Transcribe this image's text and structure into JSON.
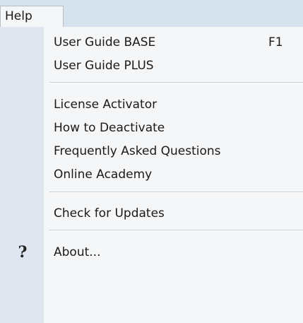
{
  "menubar": {
    "help_label": "Help"
  },
  "menu": {
    "items": [
      {
        "label": "User Guide BASE",
        "shortcut": "F1"
      },
      {
        "label": "User Guide PLUS",
        "shortcut": ""
      },
      {
        "label": "License Activator",
        "shortcut": ""
      },
      {
        "label": "How to Deactivate",
        "shortcut": ""
      },
      {
        "label": "Frequently Asked Questions",
        "shortcut": ""
      },
      {
        "label": "Online Academy",
        "shortcut": ""
      },
      {
        "label": "Check for Updates",
        "shortcut": ""
      },
      {
        "label": "About...",
        "shortcut": "",
        "icon": "question-icon"
      }
    ]
  },
  "colors": {
    "menubar_bg": "#d7e2ef",
    "menu_bg": "#f5f6f7",
    "gutter_bg": "#dfe6f0",
    "separator": "#c6ccd4"
  }
}
